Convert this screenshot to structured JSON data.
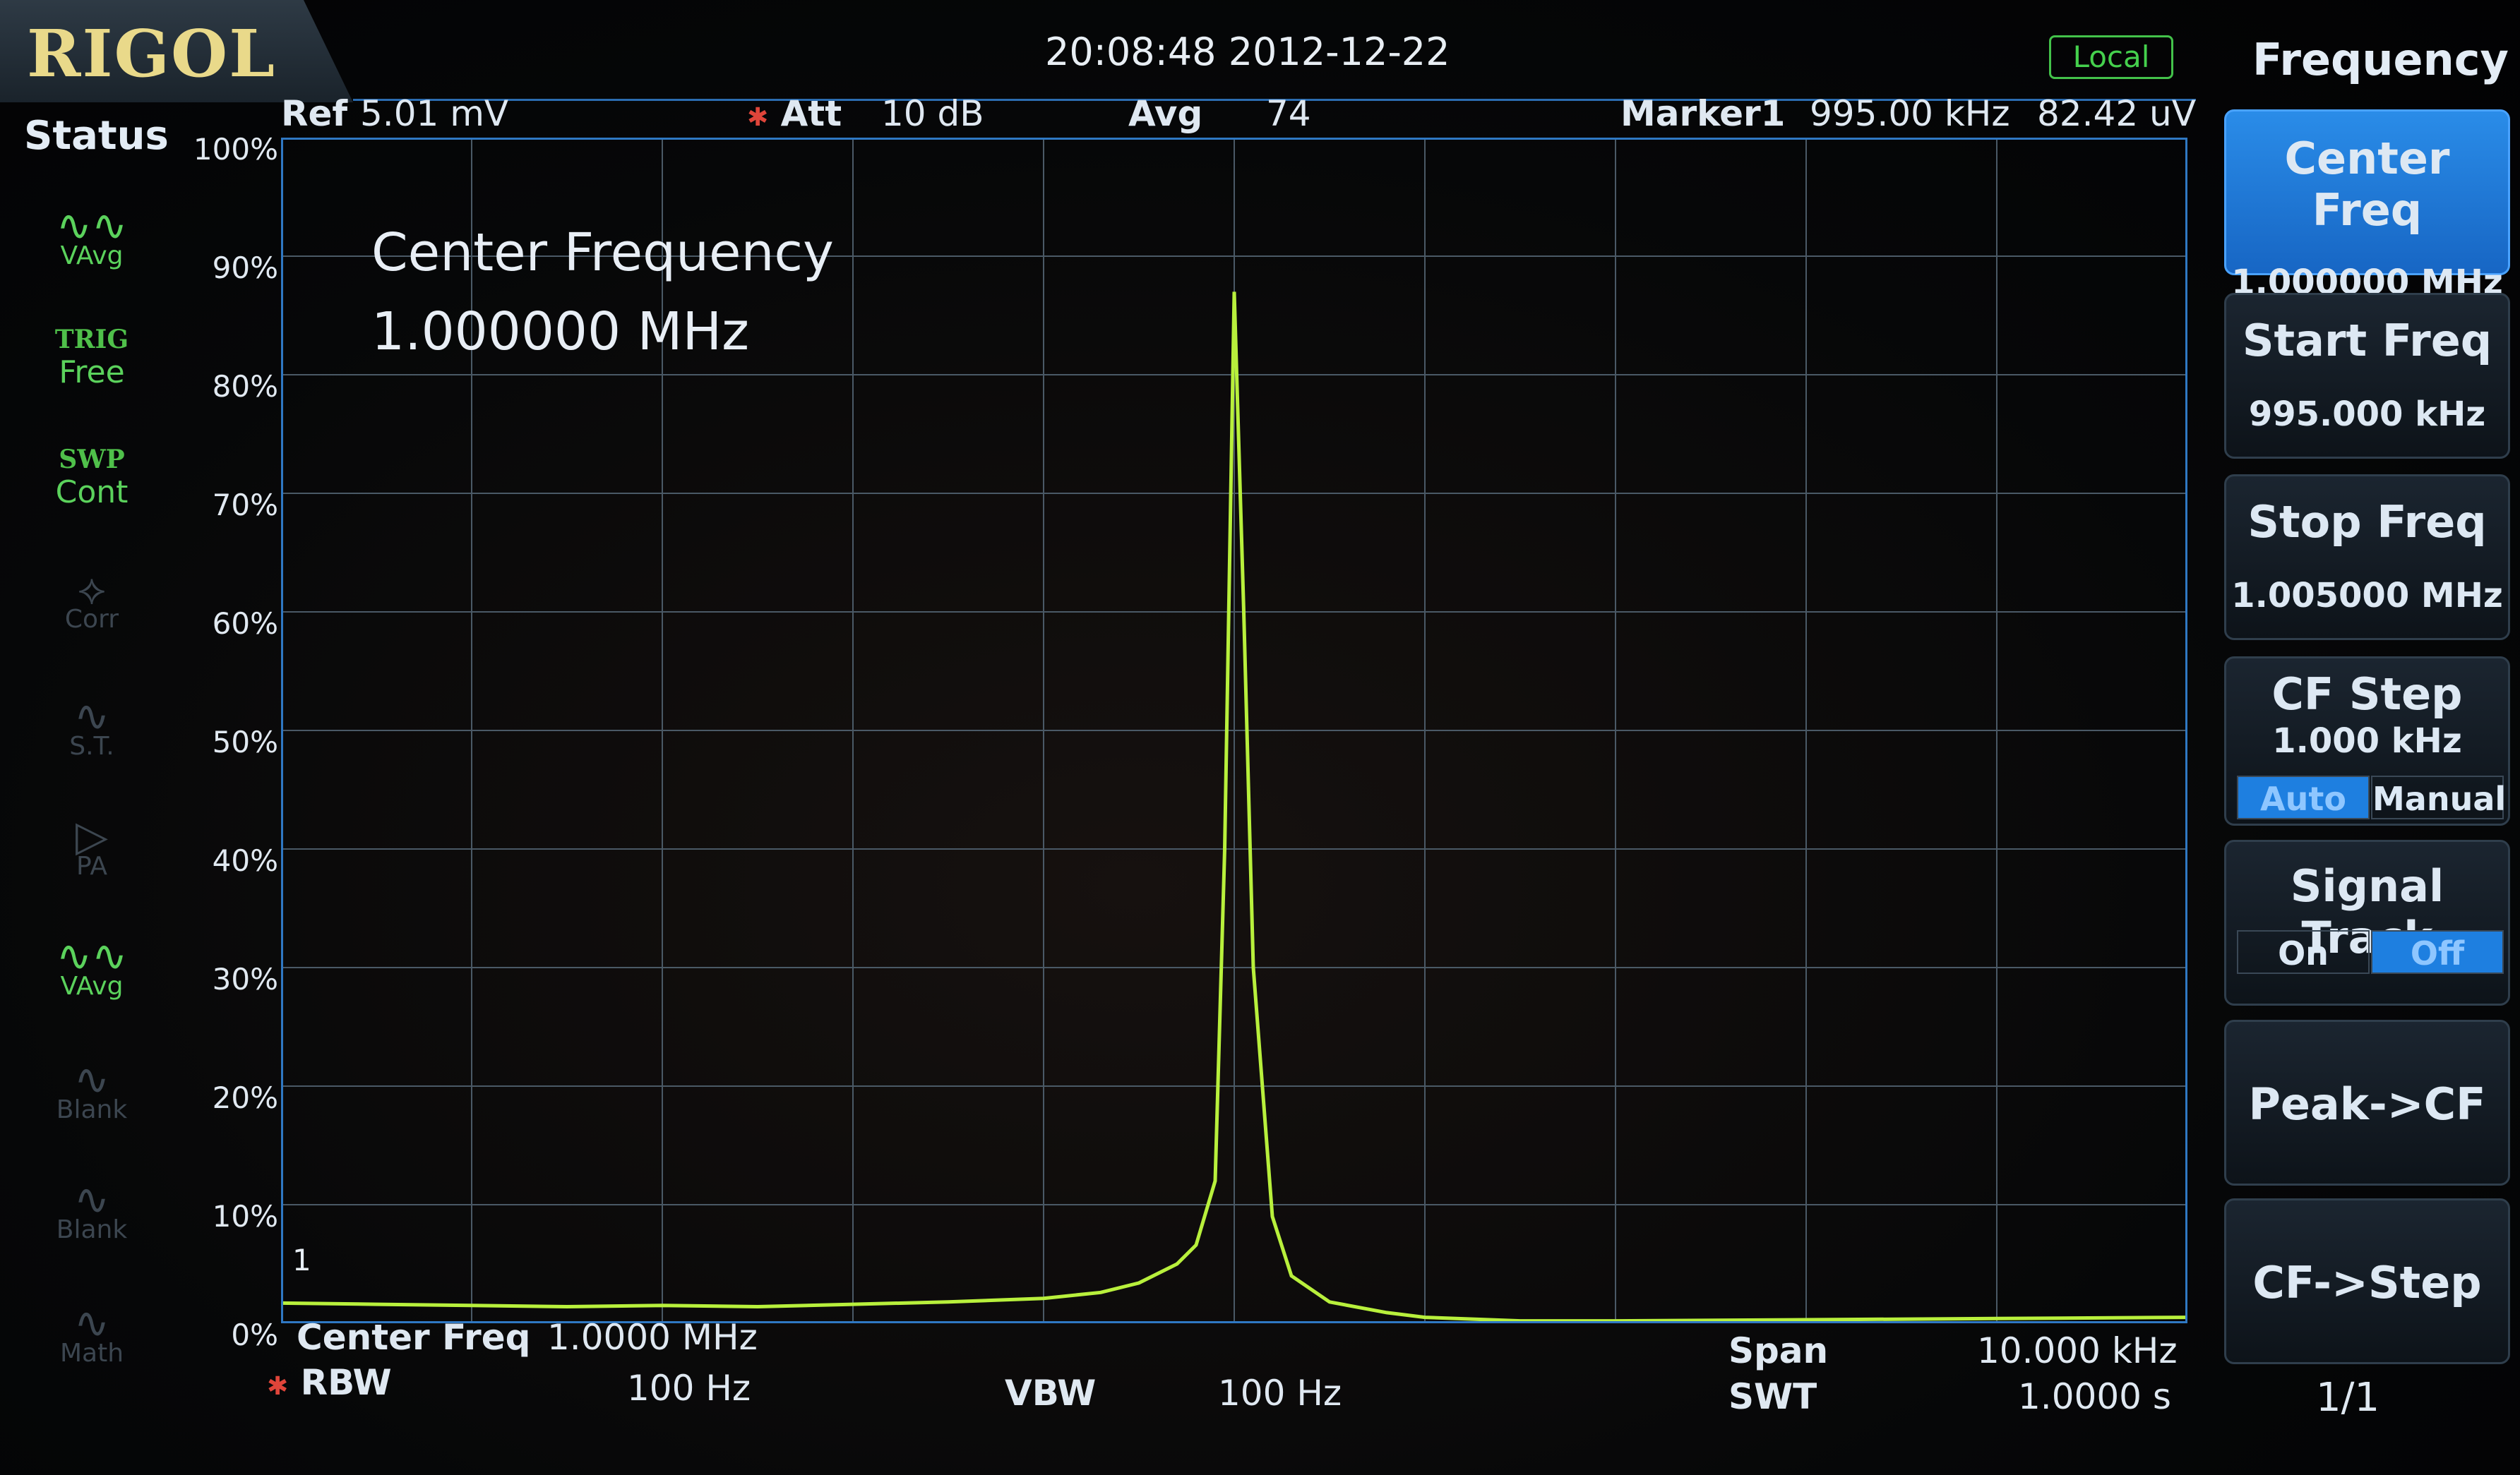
{
  "header": {
    "logo": "RIGOL",
    "datetime": "20:08:48 2012-12-22",
    "mode_badge": "Local",
    "ref_label": "Ref",
    "ref_value": "5.01 mV",
    "att_label": "Att",
    "att_value": "10 dB",
    "avg_label": "Avg",
    "avg_value": "74",
    "marker_label": "Marker1",
    "marker_freq": "995.00 kHz",
    "marker_amp": "82.42 uV"
  },
  "status": {
    "title": "Status",
    "items": [
      {
        "label": "VAvg",
        "state": "active",
        "icon": "vavg-wave-icon"
      },
      {
        "caption": "TRIG",
        "label": "Free",
        "state": "active"
      },
      {
        "caption": "SWP",
        "label": "Cont",
        "state": "active"
      },
      {
        "label": "Corr",
        "state": "dim",
        "icon": "corr-icon"
      },
      {
        "label": "S.T.",
        "state": "dim",
        "icon": "st-icon"
      },
      {
        "label": "PA",
        "state": "dim",
        "icon": "pa-icon"
      },
      {
        "label": "VAvg",
        "state": "active",
        "icon": "vavg-wave-icon"
      },
      {
        "label": "Blank",
        "state": "dim",
        "icon": "blank-icon"
      },
      {
        "label": "Blank",
        "state": "dim",
        "icon": "blank-icon"
      },
      {
        "label": "Math",
        "state": "dim",
        "icon": "math-icon"
      }
    ]
  },
  "overlay": {
    "line1": "Center Frequency",
    "line2": "1.000000 MHz"
  },
  "bottom": {
    "center_label": "Center Freq",
    "center_value": "1.0000 MHz",
    "rbw_label": "RBW",
    "rbw_value": "100 Hz",
    "vbw_label": "VBW",
    "vbw_value": "100 Hz",
    "span_label": "Span",
    "span_value": "10.000 kHz",
    "swt_label": "SWT",
    "swt_value": "1.0000 s"
  },
  "menu": {
    "title": "Frequency",
    "buttons": [
      {
        "title": "Center Freq",
        "value": "1.000000 MHz",
        "active": true
      },
      {
        "title": "Start Freq",
        "value": "995.000 kHz"
      },
      {
        "title": "Stop Freq",
        "value": "1.005000 MHz"
      },
      {
        "title": "CF Step",
        "value": "1.000 kHz",
        "toggle": [
          "Auto",
          "Manual"
        ],
        "selected": 0
      },
      {
        "title": "Signal Track",
        "toggle": [
          "On",
          "Off"
        ],
        "selected": 1
      },
      {
        "title": "Peak->CF"
      },
      {
        "title": "CF->Step"
      }
    ],
    "page": "1/1"
  },
  "colors": {
    "trace": "#b8f03c",
    "grid": "#4a5966",
    "frame": "#2f78c3",
    "accent": "#1e7fe0",
    "status_active": "#5bd25c"
  },
  "chart_data": {
    "type": "line",
    "y_ticks": [
      "100%",
      "90%",
      "80%",
      "70%",
      "60%",
      "50%",
      "40%",
      "30%",
      "20%",
      "10%",
      "0%"
    ],
    "ylim": [
      0,
      100
    ],
    "xlim": [
      995.0,
      1005.0
    ],
    "x": [
      995.0,
      995.5,
      996.0,
      996.5,
      997.0,
      997.5,
      998.0,
      998.5,
      999.0,
      999.3,
      999.5,
      999.7,
      999.8,
      999.9,
      999.95,
      1000.0,
      1000.05,
      1000.1,
      1000.2,
      1000.3,
      1000.5,
      1000.8,
      1001.0,
      1001.5,
      1002.0,
      1003.0,
      1004.0,
      1005.0
    ],
    "values": [
      1.7,
      1.6,
      1.5,
      1.4,
      1.5,
      1.4,
      1.6,
      1.8,
      2.1,
      2.6,
      3.4,
      5.0,
      6.6,
      12.0,
      40.0,
      87.0,
      60.0,
      30.0,
      9.0,
      4.0,
      1.8,
      0.9,
      0.5,
      0.2,
      0.2,
      0.3,
      0.4,
      0.5
    ],
    "grid": true,
    "legend": "none"
  }
}
